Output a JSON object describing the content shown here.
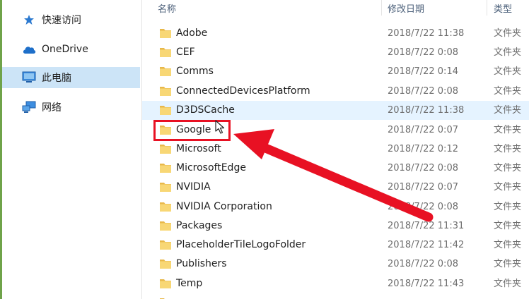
{
  "nav": {
    "items": [
      {
        "label": "快速访问",
        "icon": "star-pin-icon"
      },
      {
        "label": "OneDrive",
        "icon": "cloud-icon"
      },
      {
        "label": "此电脑",
        "icon": "computer-icon",
        "selected": true
      },
      {
        "label": "网络",
        "icon": "network-icon"
      }
    ]
  },
  "columns": {
    "name": "名称",
    "date": "修改日期",
    "type": "类型"
  },
  "files": [
    {
      "name": "Adobe",
      "date": "2018/7/22 11:38",
      "type": "文件夹"
    },
    {
      "name": "CEF",
      "date": "2018/7/22 0:08",
      "type": "文件夹"
    },
    {
      "name": "Comms",
      "date": "2018/7/22 0:14",
      "type": "文件夹"
    },
    {
      "name": "ConnectedDevicesPlatform",
      "date": "2018/7/22 0:08",
      "type": "文件夹"
    },
    {
      "name": "D3DSCache",
      "date": "2018/7/22 11:38",
      "type": "文件夹"
    },
    {
      "name": "Google",
      "date": "2018/7/22 0:07",
      "type": "文件夹"
    },
    {
      "name": "Microsoft",
      "date": "2018/7/22 0:12",
      "type": "文件夹"
    },
    {
      "name": "MicrosoftEdge",
      "date": "2018/7/22 0:08",
      "type": "文件夹"
    },
    {
      "name": "NVIDIA",
      "date": "2018/7/22 0:07",
      "type": "文件夹"
    },
    {
      "name": "NVIDIA Corporation",
      "date": "2018/7/22 0:08",
      "type": "文件夹"
    },
    {
      "name": "Packages",
      "date": "2018/7/22 11:31",
      "type": "文件夹"
    },
    {
      "name": "PlaceholderTileLogoFolder",
      "date": "2018/7/22 11:42",
      "type": "文件夹"
    },
    {
      "name": "Publishers",
      "date": "2018/7/22 0:08",
      "type": "文件夹"
    },
    {
      "name": "Temp",
      "date": "2018/7/22 11:43",
      "type": "文件夹"
    }
  ],
  "colors": {
    "selected_bg": "#cce4f7",
    "hover_bg": "#e5f3ff",
    "folder": "#f8d775",
    "annotation": "#e81123"
  }
}
